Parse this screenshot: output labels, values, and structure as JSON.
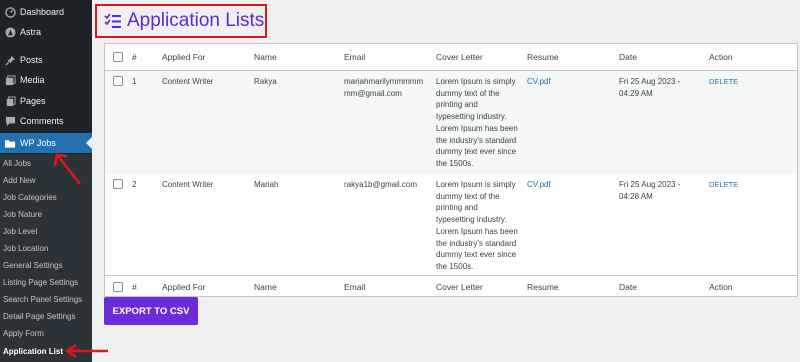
{
  "sidebar": {
    "menu": [
      {
        "label": "Dashboard",
        "icon": "dashboard-icon"
      },
      {
        "label": "Astra",
        "icon": "astra-icon"
      },
      {
        "label": "Posts",
        "icon": "pin-icon"
      },
      {
        "label": "Media",
        "icon": "media-icon"
      },
      {
        "label": "Pages",
        "icon": "pages-icon"
      },
      {
        "label": "Comments",
        "icon": "comment-icon"
      },
      {
        "label": "WP Jobs",
        "icon": "folder-icon"
      }
    ],
    "submenu": [
      "All Jobs",
      "Add New",
      "Job Categories",
      "Job Nature",
      "Job Level",
      "Job Location",
      "General Settings",
      "Listing Page Settings",
      "Search Panel Settings",
      "Detail Page Settings",
      "Apply Form",
      "Application List"
    ]
  },
  "page": {
    "title": "Application Lists",
    "title_icon": "checklist-icon"
  },
  "table": {
    "columns": [
      "#",
      "Applied For",
      "Name",
      "Email",
      "Cover Letter",
      "Resume",
      "Date",
      "Action"
    ],
    "rows": [
      {
        "num": "1",
        "applied_for": "Content Writer",
        "name": "Rakya",
        "email_lines": [
          "mariahmarilymmmmm",
          "mm@gmail.com"
        ],
        "cover_lines": [
          "Lorem Ipsum is simply",
          "dummy text of the",
          "printing and",
          "typesetting industry.",
          "Lorem Ipsum has been",
          "the industry's standard",
          "dummy text ever since",
          "the 1500s."
        ],
        "resume": "CV.pdf",
        "date_lines": [
          "Fri 25 Aug 2023 -",
          "04:29 AM"
        ],
        "action": "DELETE"
      },
      {
        "num": "2",
        "applied_for": "Content Writer",
        "name": "Mariah",
        "email_lines": [
          "rakya1b@gmail.com"
        ],
        "cover_lines": [
          "Lorem Ipsum is simply",
          "dummy text of the",
          "printing and",
          "typesetting industry.",
          "Lorem Ipsum has been",
          "the industry's standard",
          "dummy text ever since",
          "the 1500s."
        ],
        "resume": "CV.pdf",
        "date_lines": [
          "Fri 25 Aug 2023 -",
          "04:28 AM"
        ],
        "action": "DELETE"
      }
    ]
  },
  "export_button": "EXPORT TO CSV",
  "colors": {
    "sidebar": "#1d2327",
    "active": "#2271b1",
    "accent": "#6c2bd9",
    "annotation": "#e0161c"
  }
}
